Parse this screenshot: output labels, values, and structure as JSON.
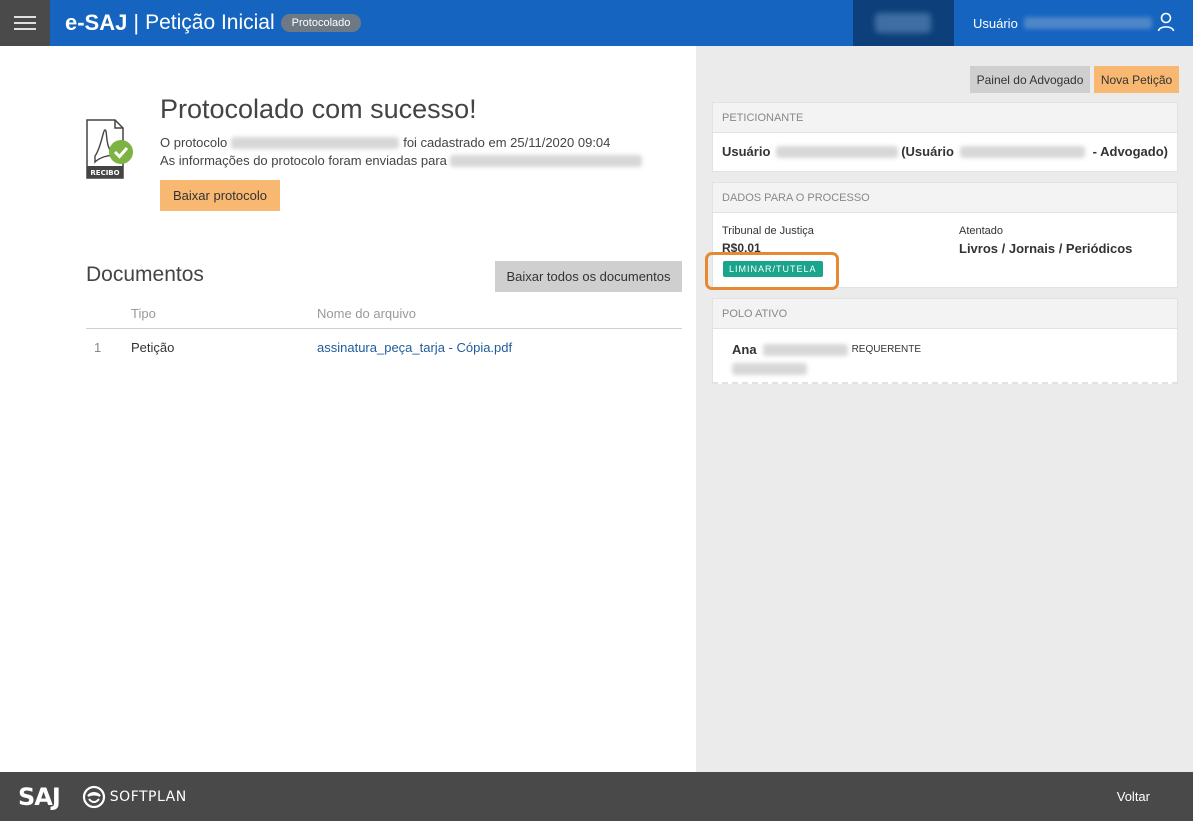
{
  "header": {
    "brand": "e-SAJ",
    "separator": "|",
    "title": "Petição Inicial",
    "status_badge": "Protocolado",
    "user_label": "Usuário"
  },
  "main": {
    "success_title": "Protocolado com sucesso!",
    "protocol_prefix": "O protocolo",
    "protocol_suffix": "foi cadastrado em 25/11/2020 09:04",
    "info_text": "As informações do protocolo foram enviadas para",
    "receipt_icon_label": "RECIBO",
    "download_button": "Baixar protocolo",
    "documents": {
      "title": "Documentos",
      "download_all_button": "Baixar todos os documentos",
      "columns": [
        "Tipo",
        "Nome do arquivo"
      ],
      "rows": [
        {
          "num": "1",
          "tipo": "Petição",
          "arquivo": "assinatura_peça_tarja - Cópia.pdf"
        }
      ]
    }
  },
  "side": {
    "painel_button": "Painel do Advogado",
    "nova_button": "Nova Petição",
    "peticionante": {
      "header": "PETICIONANTE",
      "user_prefix": "Usuário",
      "paren_prefix": "(Usuário",
      "role_suffix": "- Advogado)"
    },
    "dados": {
      "header": "DADOS PARA O PROCESSO",
      "court_label": "Tribunal de Justiça",
      "court_value": "R$0,01",
      "subject_label": "Atentado",
      "subject_value": "Livros / Jornais / Periódicos",
      "badge": "LIMINAR/TUTELA"
    },
    "polo": {
      "header": "POLO ATIVO",
      "name": "Ana",
      "role": "REQUERENTE"
    }
  },
  "footer": {
    "saj_logo": "SAJ",
    "softplan_logo": "SOFTPLAN",
    "back_link": "Voltar"
  },
  "colors": {
    "header_blue": "#1565c0",
    "accent_orange": "#f9b872",
    "badge_green": "#1aa48c",
    "highlight_orange": "#e38a32",
    "footer_gray": "#494949"
  }
}
